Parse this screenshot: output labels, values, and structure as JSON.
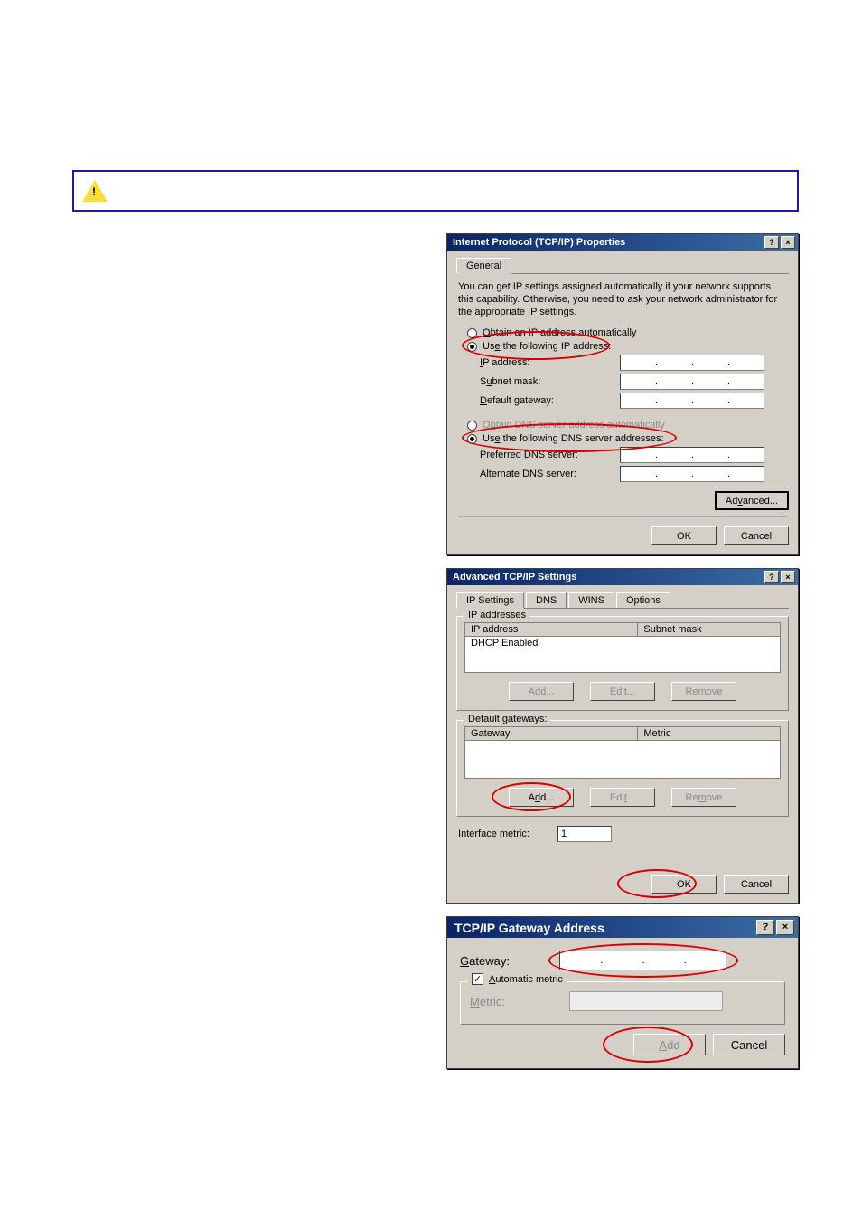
{
  "dialog1": {
    "title": "Internet Protocol (TCP/IP) Properties",
    "tabGeneral": "General",
    "description": "You can get IP settings assigned automatically if your network supports this capability. Otherwise, you need to ask your network administrator for the appropriate IP settings.",
    "obtainAuto": "Obtain an IP address automatically",
    "useFollowing": "Use the following IP address:",
    "ipAddressLabel": "IP address:",
    "subnetLabel": "Subnet mask:",
    "gatewayLabel": "Default gateway:",
    "obtainDnsAuto": "Obtain DNS server address automatically",
    "useDns": "Use the following DNS server addresses:",
    "prefDnsLabel": "Preferred DNS server:",
    "altDnsLabel": "Alternate DNS server:",
    "advanced": "Advanced...",
    "ok": "OK",
    "cancel": "Cancel"
  },
  "dialog2": {
    "title": "Advanced TCP/IP Settings",
    "tabs": {
      "ip": "IP Settings",
      "dns": "DNS",
      "wins": "WINS",
      "options": "Options"
    },
    "groupIpAddresses": "IP addresses",
    "colIpAddress": "IP address",
    "colSubnetMask": "Subnet mask",
    "dhcpEnabled": "DHCP Enabled",
    "groupGateways": "Default gateways:",
    "colGateway": "Gateway",
    "colMetric": "Metric",
    "add": "Add...",
    "edit": "Edit...",
    "remove": "Remove",
    "interfaceMetricLabel": "Interface metric:",
    "interfaceMetricValue": "1",
    "ok": "OK",
    "cancel": "Cancel"
  },
  "dialog3": {
    "title": "TCP/IP Gateway Address",
    "gatewayLabel": "Gateway:",
    "autoMetric": "Automatic metric",
    "metricLabel": "Metric:",
    "add": "Add",
    "cancel": "Cancel"
  }
}
